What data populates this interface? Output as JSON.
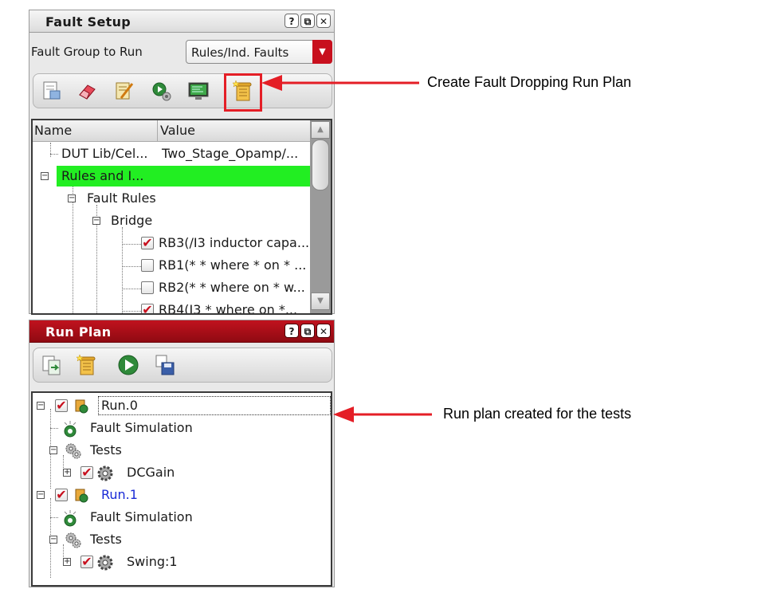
{
  "fault_setup": {
    "title": "Fault Setup",
    "help_btn": "?",
    "float_btn": "⧉",
    "close_btn": "✕",
    "group_label": "Fault Group to Run",
    "group_value": "Rules/Ind. Faults",
    "columns": {
      "name": "Name",
      "value": "Value"
    },
    "rows": [
      {
        "name": "DUT Lib/Cel...",
        "value": "Two_Stage_Opamp/..."
      },
      {
        "name": "Rules and I...",
        "value": ""
      },
      {
        "name": "Fault Rules"
      },
      {
        "name": "Bridge"
      },
      {
        "name": "RB3(/I3 inductor capa...",
        "checked": true
      },
      {
        "name": "RB1(* * where * on * ...",
        "checked": false
      },
      {
        "name": "RB2(* * where  on * w...",
        "checked": false
      },
      {
        "name": "RB4(I3 * where  on *...",
        "checked": true
      }
    ]
  },
  "run_plan": {
    "title": "Run Plan",
    "help_btn": "?",
    "float_btn": "⧉",
    "close_btn": "✕",
    "rows": [
      {
        "name": "Run.0"
      },
      {
        "name": "Fault Simulation"
      },
      {
        "name": "Tests"
      },
      {
        "name": "DCGain"
      },
      {
        "name": "Run.1"
      },
      {
        "name": "Fault Simulation"
      },
      {
        "name": "Tests"
      },
      {
        "name": "Swing:1"
      }
    ]
  },
  "annotations": {
    "create_plan": "Create Fault Dropping Run Plan",
    "run_created": "Run plan created for the tests"
  },
  "colors": {
    "accent_red": "#c8101e",
    "highlight_green": "#22ee22",
    "link_blue": "#1a2bd6"
  }
}
